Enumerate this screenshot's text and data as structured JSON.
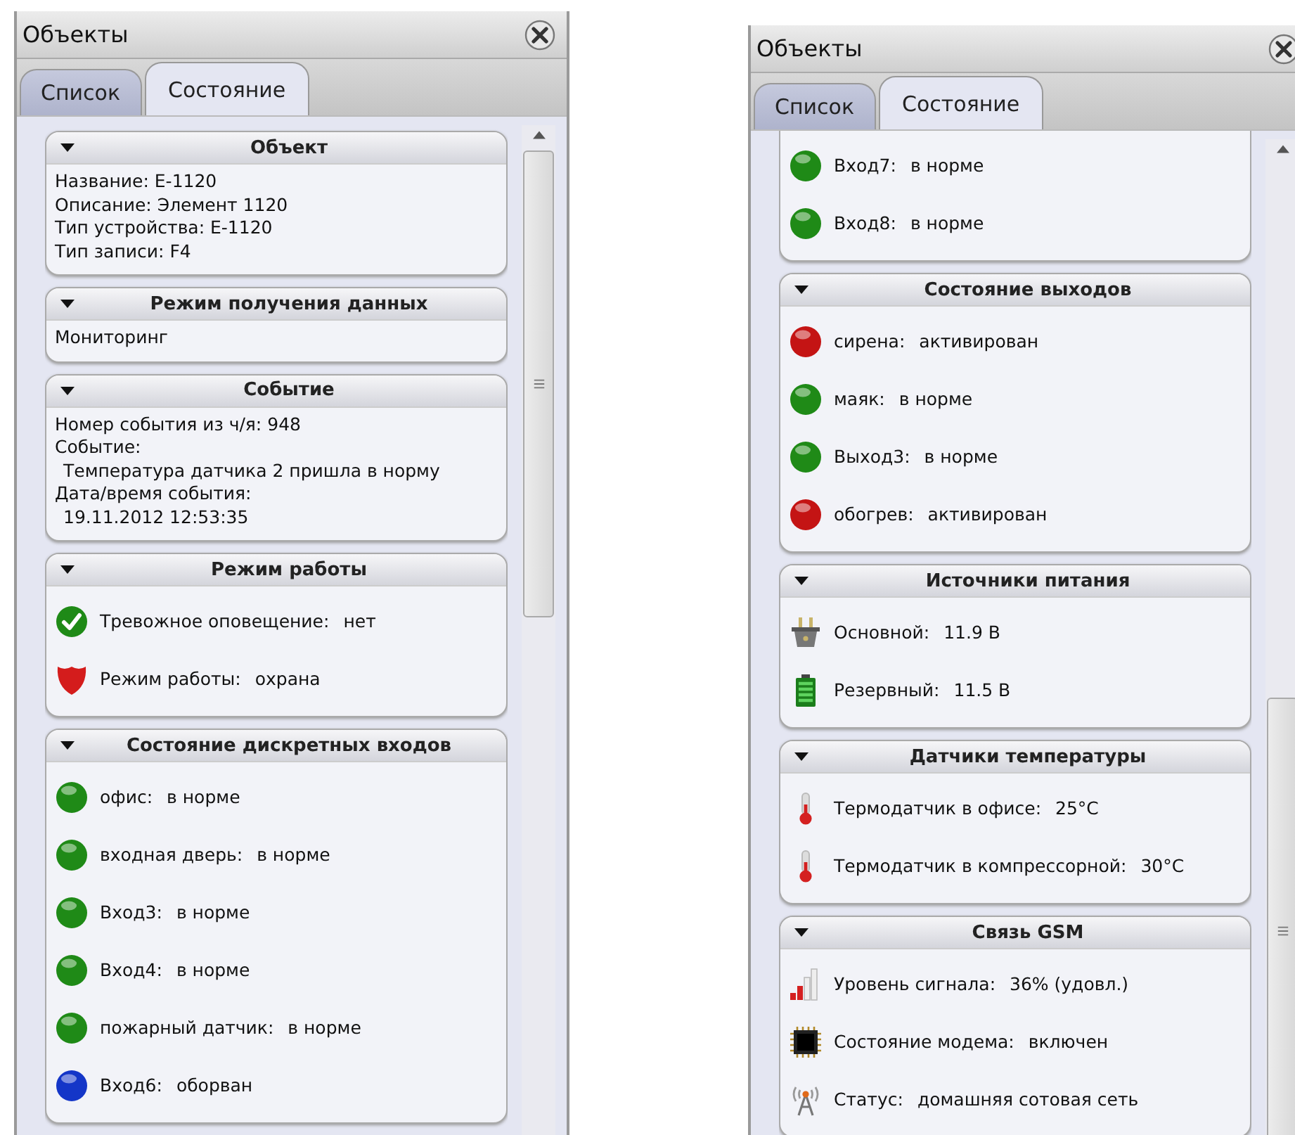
{
  "panels": [
    {
      "title": "Объекты",
      "tabs": [
        {
          "label": "Список",
          "selected": false
        },
        {
          "label": "Состояние",
          "selected": true
        }
      ],
      "sections": [
        {
          "kind": "text",
          "header": "Объект",
          "lines": [
            {
              "text": "Название:  E-1120",
              "indent": false
            },
            {
              "text": "Описание:  Элемент 1120",
              "indent": false
            },
            {
              "text": "Тип устройства:  E-1120",
              "indent": false
            },
            {
              "text": "Тип записи:  F4",
              "indent": false
            }
          ]
        },
        {
          "kind": "text",
          "header": "Режим получения данных",
          "lines": [
            {
              "text": "Мониторинг",
              "indent": false
            }
          ]
        },
        {
          "kind": "text",
          "header": "Событие",
          "lines": [
            {
              "text": "Номер события из ч/я:  948",
              "indent": false
            },
            {
              "text": "Событие:",
              "indent": false
            },
            {
              "text": "Температура датчика 2 пришла в норму",
              "indent": true
            },
            {
              "text": "Дата/время события:",
              "indent": false
            },
            {
              "text": "19.11.2012    12:53:35",
              "indent": true
            }
          ]
        },
        {
          "kind": "status",
          "header": "Режим работы",
          "items": [
            {
              "kind": "check",
              "label": "Тревожное оповещение:",
              "value": "нет"
            },
            {
              "kind": "shield",
              "label": "Режим работы:",
              "value": "охрана"
            }
          ]
        },
        {
          "kind": "status",
          "header": "Состояние дискретных входов",
          "items": [
            {
              "kind": "dot",
              "color": "#1f8a17",
              "label": "офис:",
              "value": "в норме"
            },
            {
              "kind": "dot",
              "color": "#1f8a17",
              "label": "входная дверь:",
              "value": "в норме"
            },
            {
              "kind": "dot",
              "color": "#1f8a17",
              "label": "Вход3:",
              "value": "в норме"
            },
            {
              "kind": "dot",
              "color": "#1f8a17",
              "label": "Вход4:",
              "value": "в норме"
            },
            {
              "kind": "dot",
              "color": "#1f8a17",
              "label": "пожарный датчик:",
              "value": "в норме"
            },
            {
              "kind": "dot",
              "color": "#1436c8",
              "label": "Вход6:",
              "value": "оборван"
            }
          ]
        }
      ]
    },
    {
      "title": "Объекты",
      "tabs": [
        {
          "label": "Список",
          "selected": false
        },
        {
          "label": "Состояние",
          "selected": true
        }
      ],
      "sections": [
        {
          "kind": "status",
          "items": [
            {
              "kind": "dot",
              "color": "#1f8a17",
              "label": "Вход7:",
              "value": "в норме"
            },
            {
              "kind": "dot",
              "color": "#1f8a17",
              "label": "Вход8:",
              "value": "в норме"
            }
          ]
        },
        {
          "kind": "status",
          "header": "Состояние выходов",
          "items": [
            {
              "kind": "dot",
              "color": "#c41414",
              "label": "сирена:",
              "value": "активирован"
            },
            {
              "kind": "dot",
              "color": "#1f8a17",
              "label": "маяк:",
              "value": "в норме"
            },
            {
              "kind": "dot",
              "color": "#1f8a17",
              "label": "Выход3:",
              "value": "в норме"
            },
            {
              "kind": "dot",
              "color": "#c41414",
              "label": "обогрев:",
              "value": "активирован"
            }
          ]
        },
        {
          "kind": "status",
          "header": "Источники питания",
          "items": [
            {
              "kind": "plug",
              "label": "Основной:",
              "value": "11.9 В"
            },
            {
              "kind": "battery",
              "label": "Резервный:",
              "value": "11.5 В"
            }
          ]
        },
        {
          "kind": "status",
          "header": "Датчики температуры",
          "items": [
            {
              "kind": "thermo",
              "label": "Термодатчик в офисе:",
              "value": "25°C"
            },
            {
              "kind": "thermo",
              "label": "Термодатчик в компрессорной:",
              "value": "30°C"
            }
          ]
        },
        {
          "kind": "status",
          "header": "Связь GSM",
          "items": [
            {
              "kind": "signal",
              "label": "Уровень сигнала:",
              "value": "36%  (удовл.)"
            },
            {
              "kind": "chip",
              "label": "Состояние модема:",
              "value": "включен"
            },
            {
              "kind": "antenna",
              "label": "Статус:",
              "value": "домашняя сотовая сеть"
            }
          ]
        }
      ]
    }
  ]
}
